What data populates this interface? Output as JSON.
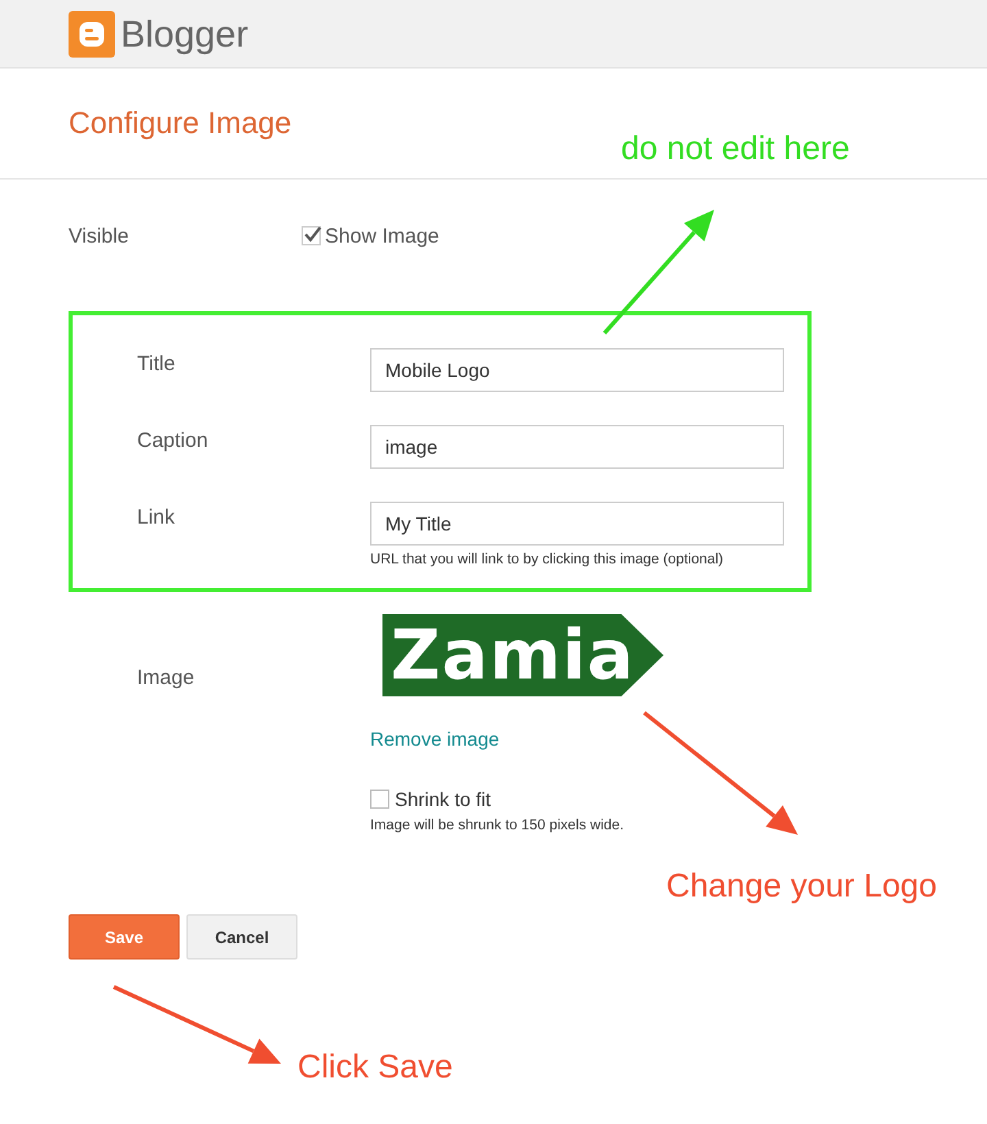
{
  "header": {
    "brand": "Blogger"
  },
  "title": "Configure Image",
  "visible": {
    "label": "Visible",
    "option": "Show Image",
    "checked": true
  },
  "fields": [
    {
      "label": "Title",
      "value": "Mobile Logo"
    },
    {
      "label": "Caption",
      "value": "image"
    },
    {
      "label": "Link",
      "value": "My Title",
      "hint": "URL that you will link to by clicking this image (optional)"
    }
  ],
  "image": {
    "label": "Image",
    "logo_text": "Zamia",
    "remove_link": "Remove image",
    "shrink": {
      "label": "Shrink to fit",
      "checked": false
    },
    "note": "Image will be shrunk to 150 pixels wide."
  },
  "buttons": [
    {
      "label": "Save",
      "kind": "primary"
    },
    {
      "label": "Cancel",
      "kind": "secondary"
    }
  ],
  "annotations": [
    {
      "text": "do not edit here",
      "color": "#33dd22"
    },
    {
      "text": "Change your Logo",
      "color": "#f04e30"
    },
    {
      "text": "Click Save",
      "color": "#f04e30"
    }
  ]
}
